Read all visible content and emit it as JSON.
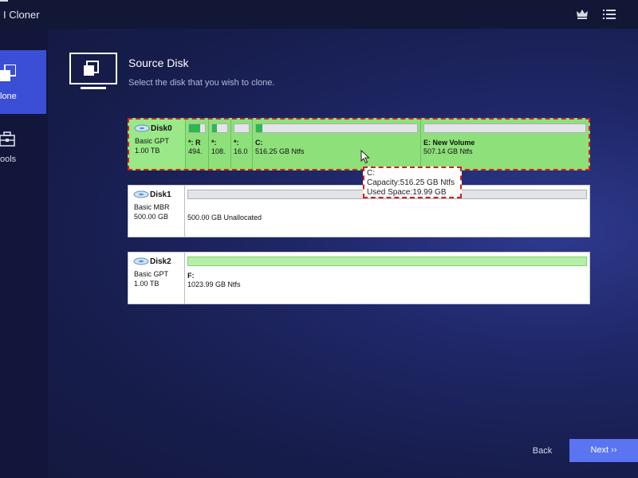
{
  "app": {
    "title": "I Cloner"
  },
  "titlebar": {
    "crown_icon": "crown-icon",
    "menu_icon": "menu-icon",
    "minimize_icon": "minimize-icon"
  },
  "sidebar": {
    "items": [
      {
        "label": "lone",
        "icon": "clone-icon",
        "active": true
      },
      {
        "label": "ools",
        "icon": "toolbox-icon",
        "active": false
      }
    ]
  },
  "header": {
    "icon": "monitor-icon",
    "title": "Source Disk",
    "subtitle": "Select the disk that you wish to clone."
  },
  "disks": [
    {
      "name": "Disk0",
      "type": "Basic GPT",
      "size": "1.00 TB",
      "selected": true,
      "partitions": [
        {
          "label": "*: R",
          "size": "494.",
          "used_fraction": 0.7
        },
        {
          "label": "*:",
          "size": "108.",
          "used_fraction": 0.3
        },
        {
          "label": "*:",
          "size": "16.0",
          "used_fraction": 0.0
        },
        {
          "label": "C:",
          "size": "516.25 GB Ntfs",
          "used_fraction": 0.04
        },
        {
          "label": "E: New Volume",
          "size": "507.14 GB Ntfs",
          "used_fraction": 0.0
        }
      ]
    },
    {
      "name": "Disk1",
      "type": "Basic MBR",
      "size": "500.00 GB",
      "selected": false,
      "unallocated": "500.00 GB Unallocated"
    },
    {
      "name": "Disk2",
      "type": "Basic GPT",
      "size": "1.00 TB",
      "selected": false,
      "partitions": [
        {
          "label": "F:",
          "size": "1023.99 GB Ntfs",
          "used_fraction": 0.0
        }
      ]
    }
  ],
  "tooltip": {
    "drive": "C:",
    "capacity": "Capacity:516.25 GB Ntfs",
    "used_space": "Used Space:19.99 GB"
  },
  "footer": {
    "back_label": "Back",
    "next_label": "Next ››"
  },
  "colors": {
    "accent": "#3a4fd6",
    "next_button": "#5a74f2",
    "selected_disk": "#8ee07a",
    "selection_border": "#d42020",
    "used_fill": "#2db84a"
  }
}
